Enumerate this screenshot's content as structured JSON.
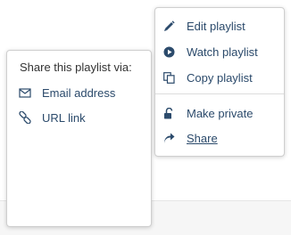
{
  "share_popover": {
    "title": "Share this playlist via:",
    "options": [
      {
        "label": "Email address",
        "icon": "envelope-icon"
      },
      {
        "label": "URL link",
        "icon": "link-icon"
      }
    ]
  },
  "playlist_menu": {
    "items": [
      {
        "label": "Edit playlist",
        "icon": "pencil-icon"
      },
      {
        "label": "Watch playlist",
        "icon": "play-circle-icon"
      },
      {
        "label": "Copy playlist",
        "icon": "copy-icon"
      },
      {
        "label": "Make private",
        "icon": "unlock-icon"
      },
      {
        "label": "Share",
        "icon": "share-arrow-icon"
      }
    ]
  },
  "colors": {
    "link_text": "#2b4a6b",
    "icon": "#2c4b6c"
  }
}
